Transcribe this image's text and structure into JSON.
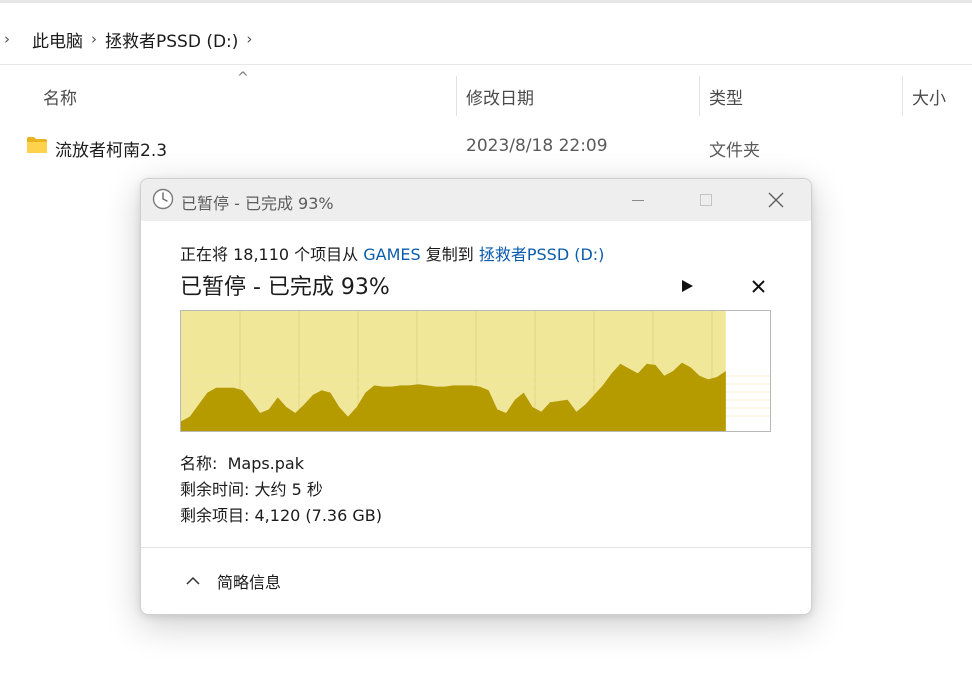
{
  "breadcrumb": {
    "items": [
      "此电脑",
      "拯救者PSSD (D:)"
    ]
  },
  "columns": {
    "name": "名称",
    "date": "修改日期",
    "type": "类型",
    "size": "大小"
  },
  "files": [
    {
      "name": "流放者柯南2.3",
      "date": "2023/8/18 22:09",
      "type": "文件夹",
      "icon": "folder-icon"
    }
  ],
  "dialog": {
    "title": "已暂停 - 已完成 93%",
    "description": {
      "prefix": "正在将 18,110 个项目从 ",
      "source": "GAMES",
      "middle": " 复制到 ",
      "destination": "拯救者PSSD (D:)"
    },
    "status": "已暂停 - 已完成 93%",
    "progress_percent": 93,
    "speed_profile": [
      8,
      12,
      22,
      32,
      36,
      36,
      36,
      34,
      25,
      15,
      18,
      28,
      20,
      15,
      22,
      30,
      34,
      32,
      20,
      12,
      20,
      32,
      38,
      37,
      37,
      38,
      38,
      39,
      38,
      37,
      37,
      38,
      38,
      38,
      37,
      34,
      18,
      15,
      26,
      32,
      20,
      16,
      24,
      25,
      26,
      16,
      22,
      30,
      38,
      48,
      56,
      52,
      48,
      56,
      55,
      46,
      50,
      57,
      53,
      46,
      43,
      45,
      50
    ],
    "details": {
      "name_label": "名称:",
      "name_value": "Maps.pak",
      "time_label": "剩余时间:",
      "time_value": "大约 5 秒",
      "items_label": "剩余项目:",
      "items_value": "4,120 (7.36 GB)"
    },
    "less_details_label": "简略信息",
    "colors": {
      "graph_bg": "#f1e799",
      "graph_fill": "#b59a00",
      "graph_grid": "#e2d67e",
      "link": "#0b5cad"
    }
  }
}
